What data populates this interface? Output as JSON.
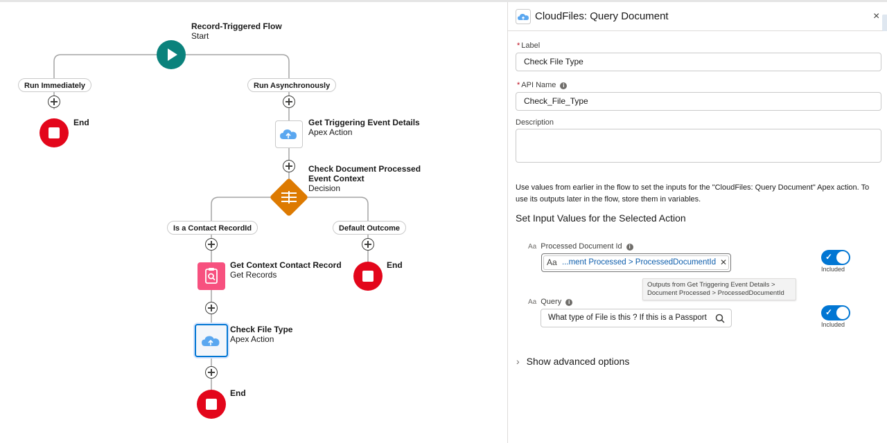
{
  "flow": {
    "start": {
      "title": "Record-Triggered Flow",
      "subtitle": "Start"
    },
    "paths": {
      "left": "Run Immediately",
      "right": "Run Asynchronously"
    },
    "end_label": "End",
    "get_trigger": {
      "title": "Get Triggering Event Details",
      "subtitle": "Apex Action"
    },
    "decision": {
      "title_line1": "Check Document Processed",
      "title_line2": "Event Context",
      "subtitle": "Decision"
    },
    "outcomes": {
      "left": "Is a Contact RecordId",
      "right": "Default Outcome"
    },
    "get_context": {
      "title": "Get Context Contact Record",
      "subtitle": "Get Records"
    },
    "check_file": {
      "title": "Check File Type",
      "subtitle": "Apex Action"
    }
  },
  "panel": {
    "title": "CloudFiles: Query Document",
    "close_glyph": "×",
    "label_field": {
      "label": "Label",
      "required_mark": "*",
      "value": "Check File Type"
    },
    "api_field": {
      "label": "API Name",
      "required_mark": "*",
      "value": "Check_File_Type",
      "info_glyph": "i"
    },
    "description_field": {
      "label": "Description",
      "value": ""
    },
    "help_text": "Use values from earlier in the flow to set the inputs for the \"CloudFiles: Query Document\" Apex action. To use its outputs later in the flow, store them in variables.",
    "section_title": "Set Input Values for the Selected Action",
    "type_glyph": "Aa",
    "params": [
      {
        "label": "Processed Document Id",
        "value": "...ment Processed > ProcessedDocumentId",
        "toggle_label": "Included"
      },
      {
        "label": "Query",
        "value": "What type of File is this ? If this is a Passport",
        "toggle_label": "Included"
      }
    ],
    "tooltip": {
      "line1": "Outputs from Get Triggering Event Details >",
      "line2": "Document Processed > ProcessedDocumentId"
    },
    "advanced_label": "Show advanced options"
  },
  "colors": {
    "start": "#0b827c",
    "end": "#e3061b",
    "decision": "#dd7a01",
    "records": "#f7517f",
    "accent": "#0176d3"
  }
}
